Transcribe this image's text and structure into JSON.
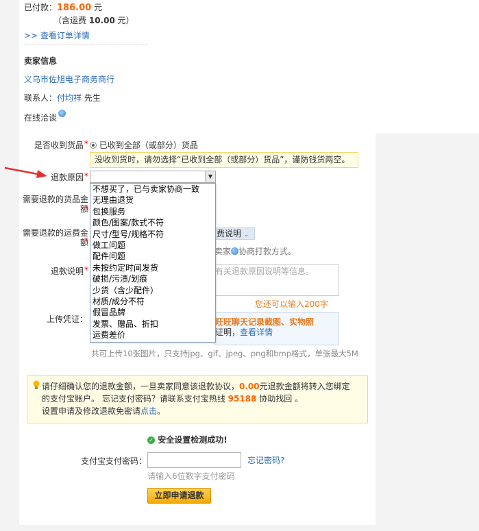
{
  "payment": {
    "paid_label": "已付款：",
    "paid_amount": "186.00",
    "paid_unit": "元",
    "shipping_prefix": "（含运费",
    "shipping_amount": "10.00",
    "shipping_suffix": "元）",
    "order_detail_link": ">> 查看订单详情"
  },
  "seller": {
    "heading": "卖家信息",
    "shop_name": "义乌市佐旭电子商务商行",
    "contact_label": "联系人：",
    "contact_name": "付均祥",
    "contact_title": "先生",
    "online_chat": "在线洽谈"
  },
  "form": {
    "received_label": "是否收到货品",
    "received_option": "已收到全部（或部分）货品",
    "received_notice": "没收到货时，请勿选择“已收到全部（或部分）货品”，谨防钱货两空。",
    "reason_label": "退款原因",
    "reason_value": "",
    "goods_amount_label_1": "需要退款的货品金",
    "goods_amount_label_2": "额",
    "shipping_amount_label_1": "需要退款的运费金",
    "shipping_amount_label_2": "额",
    "shipping_tag_partial": "费说明",
    "negotiate_partial_1": "卖家",
    "negotiate_partial_2": "协商打款方式。",
    "description_label": "退款说明",
    "description_placeholder_partial": "有关退款原因说明等信息。",
    "char_limit": "您还可以输入200字",
    "upload_label": "上传凭证：",
    "upload_hint_line1": "旺旺聊天记录截图、实物照",
    "upload_hint_line2_prefix": "证明，",
    "upload_hint_link": "查看详情",
    "upload_rules": "共可上传10张图片，只支持jpg、gif、jpeg、png和bmp格式，单张最大5M"
  },
  "reason_options": [
    "不想买了，已与卖家协商一致",
    "无理由退货",
    "包换服务",
    "颜色/图案/款式不符",
    "尺寸/型号/规格不符",
    "做工问题",
    "配件问题",
    "未按约定时间发货",
    "破损/污渍/划痕",
    "少货（含少配件）",
    "材质/成分不符",
    "假冒品牌",
    "发票、赠品、折扣",
    "运费差价"
  ],
  "confirm_notice": {
    "line1_prefix": "请仔细确认您的退款金额，一旦卖家同意该退款协议，",
    "amount": "0.00",
    "line1_suffix": "元退款金额将转入您绑定",
    "line2_prefix": "的支付宝账户。 忘记支付密码？请联系支付宝热线",
    "hotline": "95188",
    "line2_suffix": "协助找回 。",
    "line3_prefix": "设置申请及修改退款免密请",
    "line3_link": "点击",
    "line3_suffix": "。"
  },
  "security": {
    "check_ok": "安全设置检测成功!",
    "password_label": "支付宝支付密码：",
    "password_value": "",
    "forgot_link": "忘记密码?",
    "password_hint": "请输入6位数字支付密码",
    "submit_label": "立即申请退款"
  },
  "colors": {
    "link": "#2b6cb7",
    "accent_orange": "#ff6600",
    "required_star": "#e00000",
    "arrow": "#e53030"
  }
}
